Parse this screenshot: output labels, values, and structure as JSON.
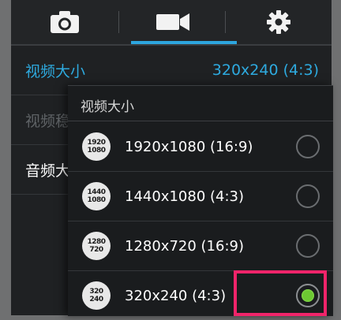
{
  "tabs": {
    "camera_icon": "camera-icon",
    "video_icon": "video-camera-icon",
    "settings_icon": "gear-icon",
    "active": "video"
  },
  "settings": {
    "video_size": {
      "label": "视频大小",
      "value": "320x240 (4:3)"
    },
    "video_stabilization": {
      "label": "视频稳"
    },
    "audio": {
      "label": "音频大"
    }
  },
  "dialog": {
    "title": "视频大小",
    "options": [
      {
        "icon_top": "1920",
        "icon_bottom": "1080",
        "label": "1920x1080 (16:9)",
        "selected": false
      },
      {
        "icon_top": "1440",
        "icon_bottom": "1080",
        "label": "1440x1080 (4:3)",
        "selected": false
      },
      {
        "icon_top": "1280",
        "icon_bottom": "720",
        "label": "1280x720 (16:9)",
        "selected": false
      },
      {
        "icon_top": "320",
        "icon_bottom": "240",
        "label": "320x240 (4:3)",
        "selected": true
      }
    ]
  },
  "colors": {
    "accent": "#2eaadf",
    "selected_radio": "#6cc832",
    "highlight": "#f0246a"
  }
}
